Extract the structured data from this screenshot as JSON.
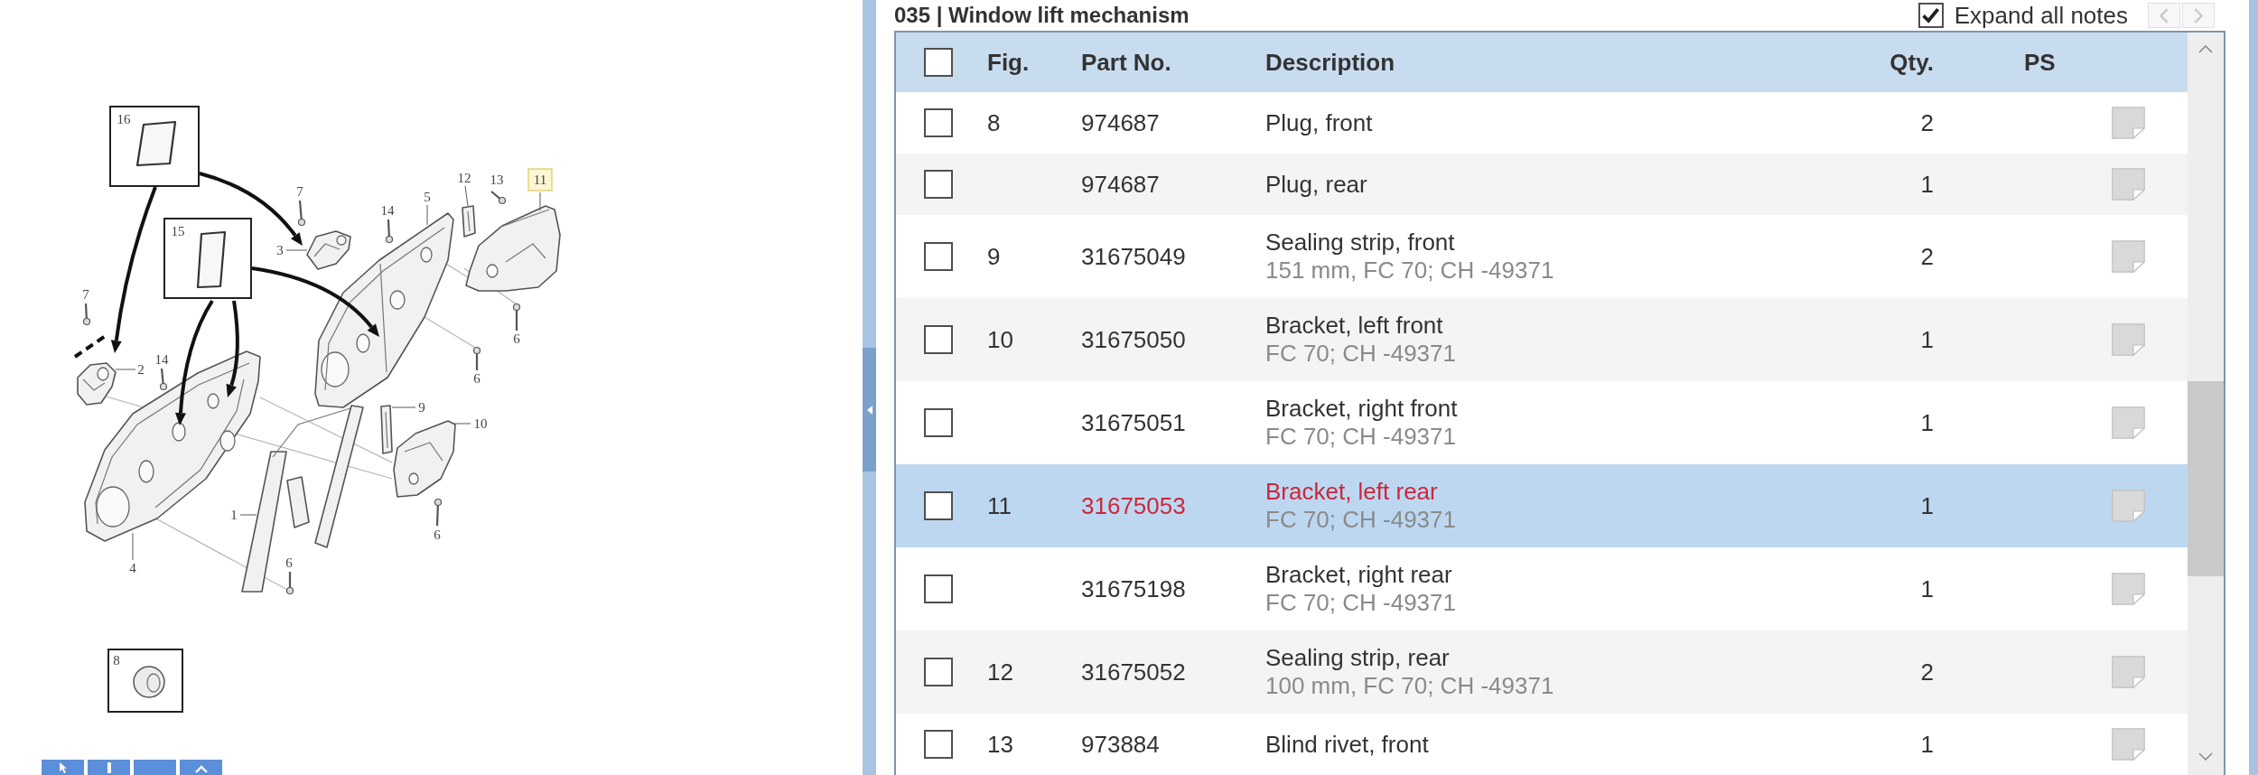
{
  "diagram": {
    "callouts": [
      {
        "label": "16",
        "selected": false
      },
      {
        "label": "12",
        "selected": false
      },
      {
        "label": "13",
        "selected": false
      },
      {
        "label": "11",
        "selected": true
      },
      {
        "label": "7",
        "selected": false
      },
      {
        "label": "5",
        "selected": false
      },
      {
        "label": "14",
        "selected": false
      },
      {
        "label": "15",
        "selected": false
      },
      {
        "label": "3",
        "selected": false
      },
      {
        "label": "7",
        "selected": false
      },
      {
        "label": "6",
        "selected": false
      },
      {
        "label": "14",
        "selected": false
      },
      {
        "label": "2",
        "selected": false
      },
      {
        "label": "6",
        "selected": false
      },
      {
        "label": "9",
        "selected": false
      },
      {
        "label": "10",
        "selected": false
      },
      {
        "label": "1",
        "selected": false
      },
      {
        "label": "6",
        "selected": false
      },
      {
        "label": "6",
        "selected": false
      },
      {
        "label": "4",
        "selected": false
      },
      {
        "label": "8",
        "selected": false
      }
    ]
  },
  "parts_panel": {
    "title": "035 | Window lift mechanism",
    "expand_notes": {
      "label": "Expand all notes",
      "checked": true
    },
    "pager": [
      {
        "kind": "prev",
        "disabled": true
      },
      {
        "kind": "next",
        "disabled": true
      }
    ]
  },
  "table": {
    "select_all": {
      "checked": false
    },
    "columns": [
      "Fig.",
      "Part No.",
      "Description",
      "Qty.",
      "PS"
    ],
    "rows": [
      {
        "checked": false,
        "selected": false,
        "fig": "8",
        "part_no": "974687",
        "description": "Plug, front",
        "qty": "2"
      },
      {
        "checked": false,
        "selected": false,
        "part_no": "974687",
        "description": "Plug, rear",
        "qty": "1"
      },
      {
        "checked": false,
        "selected": false,
        "fig": "9",
        "part_no": "31675049",
        "description": "Sealing strip, front",
        "remark": "151 mm, FC 70; CH -49371",
        "qty": "2"
      },
      {
        "checked": false,
        "selected": false,
        "fig": "10",
        "part_no": "31675050",
        "description": "Bracket, left front",
        "remark": "FC 70; CH -49371",
        "qty": "1"
      },
      {
        "checked": false,
        "selected": false,
        "part_no": "31675051",
        "description": "Bracket, right front",
        "remark": "FC 70; CH -49371",
        "qty": "1"
      },
      {
        "checked": false,
        "selected": true,
        "fig": "11",
        "part_no": "31675053",
        "description": "Bracket, left rear",
        "remark": "FC 70; CH -49371",
        "qty": "1"
      },
      {
        "checked": false,
        "selected": false,
        "part_no": "31675198",
        "description": "Bracket, right rear",
        "remark": "FC 70; CH -49371",
        "qty": "1"
      },
      {
        "checked": false,
        "selected": false,
        "fig": "12",
        "part_no": "31675052",
        "description": "Sealing strip, rear",
        "remark": "100 mm, FC 70; CH -49371",
        "qty": "2"
      },
      {
        "checked": false,
        "selected": false,
        "fig": "13",
        "part_no": "973884",
        "description": "Blind rivet, front",
        "qty": "1"
      }
    ]
  }
}
